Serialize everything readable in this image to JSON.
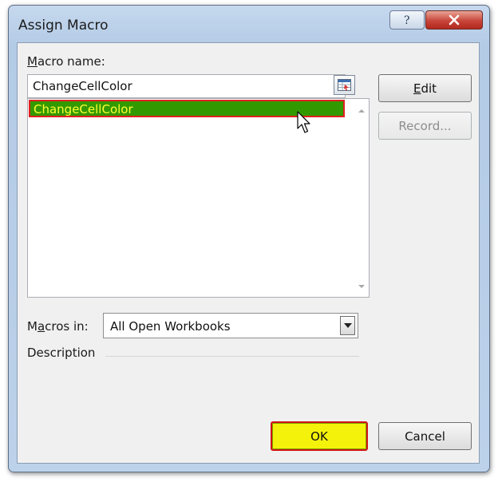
{
  "window": {
    "title": "Assign Macro"
  },
  "labels": {
    "macro_name_first": "M",
    "macro_name_rest": "acro name:",
    "macros_in_first": "M",
    "macros_in_u": "a",
    "macros_in_rest": "cros in:",
    "description": "Description"
  },
  "macro_name_input": {
    "value": "ChangeCellColor"
  },
  "macro_list": {
    "items": [
      "ChangeCellColor"
    ],
    "selected_index": 0
  },
  "buttons": {
    "edit_u": "E",
    "edit_rest": "dit",
    "record": "Record...",
    "ok": "OK",
    "cancel": "Cancel"
  },
  "macros_in_select": {
    "value": "All Open Workbooks"
  },
  "icons": [
    "help-icon",
    "close-icon",
    "range-picker-icon",
    "scroll-up-icon",
    "scroll-down-icon",
    "dropdown-arrow-icon",
    "mouse-cursor-icon"
  ],
  "colors": {
    "selection_bg": "#339900",
    "selection_text": "#ffff33",
    "highlight_border": "#e02020",
    "ok_bg": "#f4f20a"
  }
}
